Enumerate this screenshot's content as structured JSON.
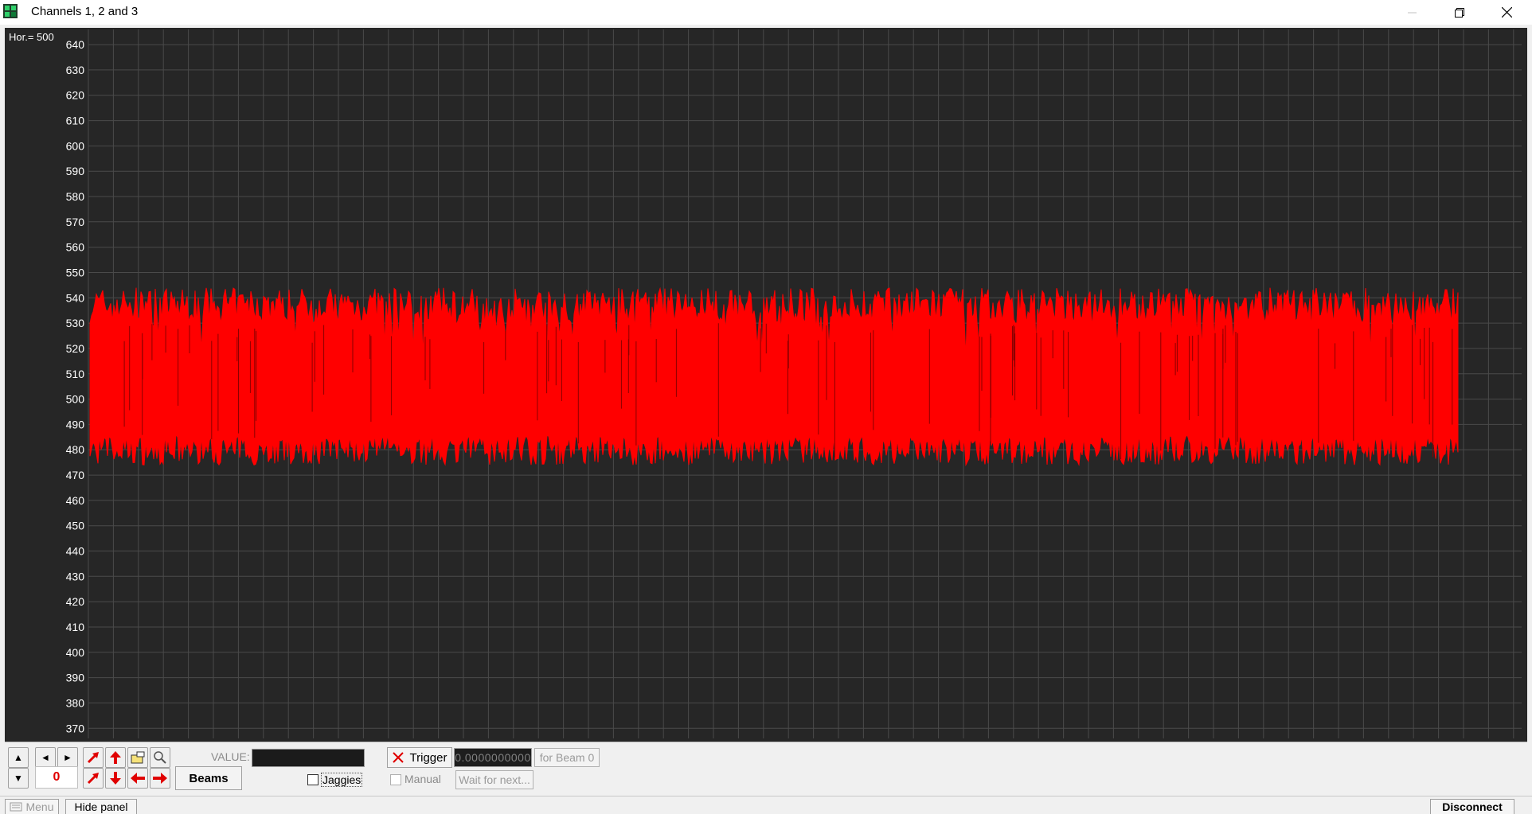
{
  "window": {
    "title": "Channels 1, 2 and 3",
    "controls": [
      "minimize-icon",
      "restore-icon",
      "close-icon"
    ]
  },
  "plot": {
    "hor_label": "Hor.= 500",
    "background": "#262626",
    "grid_color": "#4a4a4a",
    "trace_color": "#ff0000"
  },
  "chart_data": {
    "type": "line",
    "y_ticks": [
      640,
      630,
      620,
      610,
      600,
      590,
      580,
      570,
      560,
      550,
      540,
      530,
      520,
      510,
      500,
      490,
      480,
      470,
      460,
      450,
      440,
      430,
      420,
      410,
      400,
      390,
      380,
      370
    ],
    "ylim": [
      366,
      646
    ],
    "upper_envelope_range": [
      530,
      544
    ],
    "lower_envelope_range": [
      474,
      486
    ],
    "series": [
      {
        "values_band": [
          477,
          540
        ]
      }
    ],
    "grid": true
  },
  "panel": {
    "beam_number": "0",
    "beams_label": "Beams",
    "value_label": "VALUE:",
    "jaggies_label": "Jaggies",
    "trigger_label": "Trigger",
    "trigger_value": "0.0000000000",
    "for_beam_label": "for Beam 0",
    "manual_label": "Manual",
    "wait_label": "Wait for next..."
  },
  "statusbar": {
    "menu_label": "Menu",
    "hide_panel_label": "Hide panel",
    "disconnect_label": "Disconnect"
  }
}
